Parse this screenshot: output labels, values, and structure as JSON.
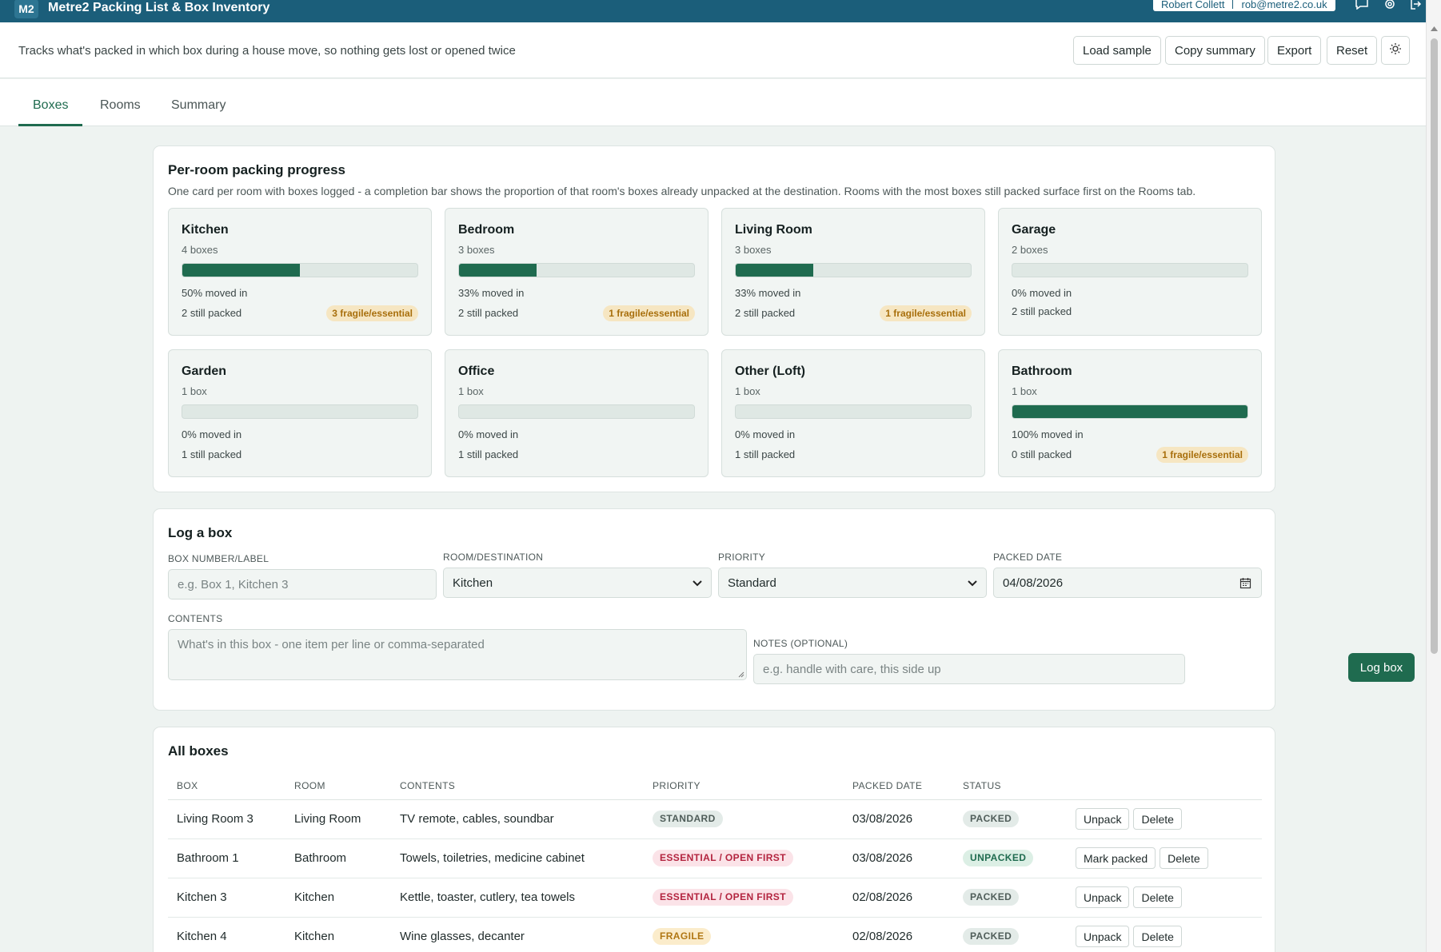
{
  "app": {
    "logo": "M2",
    "title": "Metre2 Packing List & Box Inventory",
    "user_name": "Robert Collett",
    "user_email": "rob@metre2.co.uk",
    "tagline": "Tracks what's packed in which box during a house move, so nothing gets lost or opened twice"
  },
  "toolbar": {
    "load_sample": "Load sample",
    "copy_summary": "Copy summary",
    "export": "Export",
    "reset": "Reset",
    "theme_icon": "sun-icon"
  },
  "tabs": [
    {
      "label": "Boxes",
      "active": true
    },
    {
      "label": "Rooms",
      "active": false
    },
    {
      "label": "Summary",
      "active": false
    }
  ],
  "progress": {
    "title": "Per-room packing progress",
    "description": "One card per room with boxes logged - a completion bar shows the proportion of that room's boxes already unpacked at the destination. Rooms with the most boxes still packed surface first on the Rooms tab.",
    "rooms": [
      {
        "name": "Kitchen",
        "count": "4 boxes",
        "pct": 50,
        "pct_label": "50% moved in",
        "packed": "2 still packed",
        "badge": "3 fragile/essential"
      },
      {
        "name": "Bedroom",
        "count": "3 boxes",
        "pct": 33,
        "pct_label": "33% moved in",
        "packed": "2 still packed",
        "badge": "1 fragile/essential"
      },
      {
        "name": "Living Room",
        "count": "3 boxes",
        "pct": 33,
        "pct_label": "33% moved in",
        "packed": "2 still packed",
        "badge": "1 fragile/essential"
      },
      {
        "name": "Garage",
        "count": "2 boxes",
        "pct": 0,
        "pct_label": "0% moved in",
        "packed": "2 still packed",
        "badge": ""
      },
      {
        "name": "Garden",
        "count": "1 box",
        "pct": 0,
        "pct_label": "0% moved in",
        "packed": "1 still packed",
        "badge": ""
      },
      {
        "name": "Office",
        "count": "1 box",
        "pct": 0,
        "pct_label": "0% moved in",
        "packed": "1 still packed",
        "badge": ""
      },
      {
        "name": "Other (Loft)",
        "count": "1 box",
        "pct": 0,
        "pct_label": "0% moved in",
        "packed": "1 still packed",
        "badge": ""
      },
      {
        "name": "Bathroom",
        "count": "1 box",
        "pct": 100,
        "pct_label": "100% moved in",
        "packed": "0 still packed",
        "badge": "1 fragile/essential"
      }
    ]
  },
  "form": {
    "title": "Log a box",
    "box_label": "BOX NUMBER/LABEL",
    "box_placeholder": "e.g. Box 1, Kitchen 3",
    "room_label": "ROOM/DESTINATION",
    "room_value": "Kitchen",
    "priority_label": "PRIORITY",
    "priority_value": "Standard",
    "date_label": "PACKED DATE",
    "date_value": "04/08/2026",
    "contents_label": "CONTENTS",
    "contents_placeholder": "What's in this box - one item per line or comma-separated",
    "notes_label": "NOTES (OPTIONAL)",
    "notes_placeholder": "e.g. handle with care, this side up",
    "submit": "Log box"
  },
  "boxes": {
    "title": "All boxes",
    "columns": [
      "BOX",
      "ROOM",
      "CONTENTS",
      "PRIORITY",
      "PACKED DATE",
      "STATUS"
    ],
    "rows": [
      {
        "box": "Living Room 3",
        "room": "Living Room",
        "contents": "TV remote, cables, soundbar",
        "priority": "STANDARD",
        "priority_kind": "standard",
        "date": "03/08/2026",
        "status": "PACKED",
        "action": "Unpack",
        "delete": "Delete"
      },
      {
        "box": "Bathroom 1",
        "room": "Bathroom",
        "contents": "Towels, toiletries, medicine cabinet",
        "priority": "ESSENTIAL / OPEN FIRST",
        "priority_kind": "essential",
        "date": "03/08/2026",
        "status": "UNPACKED",
        "action": "Mark packed",
        "delete": "Delete"
      },
      {
        "box": "Kitchen 3",
        "room": "Kitchen",
        "contents": "Kettle, toaster, cutlery, tea towels",
        "priority": "ESSENTIAL / OPEN FIRST",
        "priority_kind": "essential",
        "date": "02/08/2026",
        "status": "PACKED",
        "action": "Unpack",
        "delete": "Delete"
      },
      {
        "box": "Kitchen 4",
        "room": "Kitchen",
        "contents": "Wine glasses, decanter",
        "priority": "FRAGILE",
        "priority_kind": "fragile",
        "date": "02/08/2026",
        "status": "PACKED",
        "action": "Unpack",
        "delete": "Delete"
      }
    ]
  },
  "colors": {
    "brand": "#1b5e7a",
    "accent": "#1f6b4f",
    "standard_bg": "#e3ebe8",
    "standard_fg": "#4f5d59",
    "essential_bg": "#fbe3e8",
    "essential_fg": "#b3243f",
    "fragile_bg": "#fbeccb",
    "fragile_fg": "#b07613",
    "packed_bg": "#e3ebe8",
    "packed_fg": "#4f5d59",
    "unpacked_bg": "#dcefe5",
    "unpacked_fg": "#1f6b4f"
  }
}
